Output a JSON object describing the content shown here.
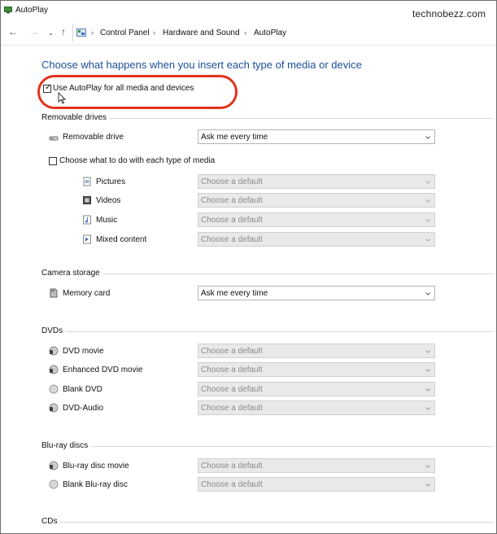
{
  "window": {
    "title": "AutoPlay"
  },
  "watermark": "technobezz.com",
  "address": {
    "breadcrumbs": [
      "Control Panel",
      "Hardware and Sound",
      "AutoPlay"
    ]
  },
  "heading": "Choose what happens when you insert each type of media or device",
  "use_autoplay": {
    "label": "Use AutoPlay for all media and devices",
    "checked": true
  },
  "removable": {
    "title": "Removable drives",
    "drive": {
      "label": "Removable drive",
      "value": "Ask me every time"
    },
    "per_type": {
      "label": "Choose what to do with each type of media",
      "checked": false
    },
    "types": [
      {
        "label": "Pictures",
        "value": "Choose a default"
      },
      {
        "label": "Videos",
        "value": "Choose a default"
      },
      {
        "label": "Music",
        "value": "Choose a default"
      },
      {
        "label": "Mixed content",
        "value": "Choose a default"
      }
    ]
  },
  "camera": {
    "title": "Camera storage",
    "items": [
      {
        "label": "Memory card",
        "value": "Ask me every time"
      }
    ]
  },
  "dvds": {
    "title": "DVDs",
    "items": [
      {
        "label": "DVD movie",
        "value": "Choose a default"
      },
      {
        "label": "Enhanced DVD movie",
        "value": "Choose a default"
      },
      {
        "label": "Blank DVD",
        "value": "Choose a default"
      },
      {
        "label": "DVD-Audio",
        "value": "Choose a default"
      }
    ]
  },
  "bluray": {
    "title": "Blu-ray discs",
    "items": [
      {
        "label": "Blu-ray disc movie",
        "value": "Choose a default"
      },
      {
        "label": "Blank Blu-ray disc",
        "value": "Choose a default"
      }
    ]
  },
  "cds": {
    "title": "CDs"
  },
  "colors": {
    "heading": "#1c4f9c",
    "highlight": "#e4321b"
  }
}
